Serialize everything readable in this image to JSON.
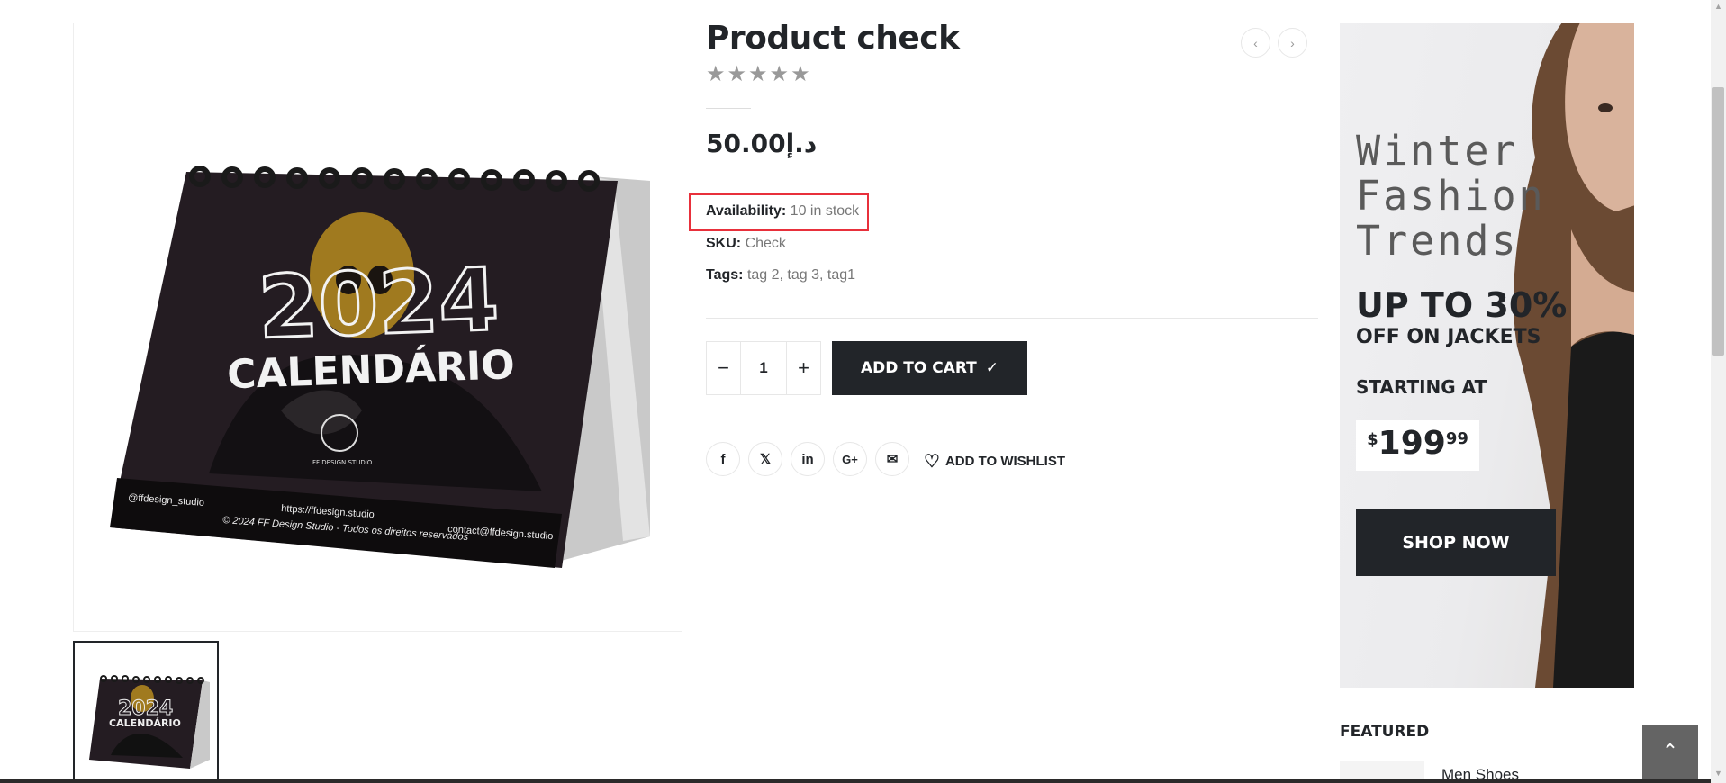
{
  "product": {
    "title": "Product check",
    "rating_stars": 5,
    "rating_value": 0,
    "price": "50.00د.إ",
    "availability_label": "Availability:",
    "availability_value": "10 in stock",
    "sku_label": "SKU:",
    "sku_value": "Check",
    "tags_label": "Tags:",
    "tags": [
      "tag 2",
      "tag 3",
      "tag1"
    ],
    "quantity": "1",
    "add_to_cart_label": "ADD TO CART",
    "wishlist_label": "ADD TO WISHLIST",
    "share_icons": [
      "facebook-icon",
      "x-twitter-icon",
      "linkedin-icon",
      "google-plus-icon",
      "email-icon"
    ]
  },
  "gallery": {
    "calendar_year": "2024",
    "calendar_title": "CALENDÁRIO",
    "calendar_studio": "FF DESIGN STUDIO",
    "calendar_handle": "@ffdesign_studio",
    "calendar_url": "https://ffdesign.studio",
    "calendar_copyright": "© 2024 FF Design Studio - Todos os direitos reservados",
    "calendar_contact": "contact@ffdesign.studio"
  },
  "banner": {
    "script_line1": "Winter",
    "script_line2": "Fashion",
    "script_line3": "Trends",
    "headline": "UP TO 30%",
    "subline": "OFF ON JACKETS",
    "starting": "STARTING AT",
    "price_currency": "$",
    "price_whole": "199",
    "price_cents": "99",
    "cta": "SHOP NOW"
  },
  "sidebar": {
    "featured_title": "FEATURED",
    "featured_item": "Men Shoes"
  },
  "colors": {
    "dark": "#222529",
    "highlight_border": "#e8303b",
    "muted_text": "#777777",
    "border": "#e7e7e7"
  }
}
